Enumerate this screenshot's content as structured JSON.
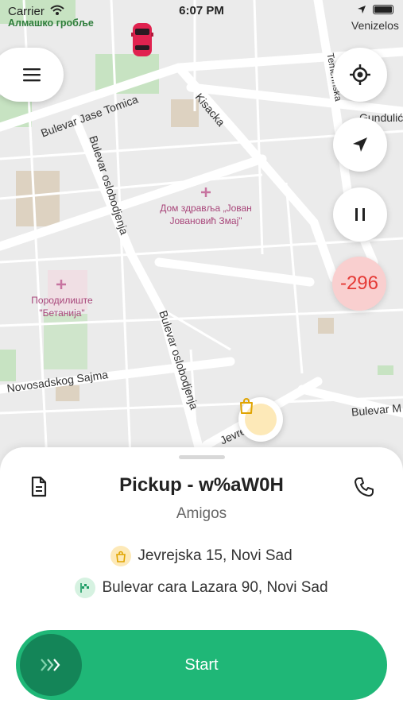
{
  "status_bar": {
    "carrier": "Carrier",
    "time": "6:07 PM"
  },
  "map": {
    "cemetery_label": "Алмашко гробље",
    "street_labels": {
      "bulevar_jase_tomica": "Bulevar Jase Tomica",
      "kisacka": "Kisacka",
      "bulevar_oslobodjenja_1": "Bulevar oslobodjenja",
      "bulevar_oslobodjenja_2": "Bulevar oslobodjenja",
      "novosadskog_sajma": "Novosadskog Sajma",
      "venizelosova": "Venizelos",
      "temerinska": "Temerinska",
      "gundulic": "Gundulić",
      "bulevar_m": "Bulevar M",
      "jevrejska": "Jevre"
    },
    "poi": {
      "dom_zdravlja": "Дом здравља „Јован Јовановић Змај\"",
      "porodiliste": "Породилиште \"Бетанија\""
    }
  },
  "controls": {
    "score_value": "-296",
    "icons": {
      "menu": "menu-icon",
      "locate": "crosshair-icon",
      "navigate": "navigation-arrow-icon",
      "pause": "pause-icon",
      "pickup_pin": "shopping-bag-icon"
    }
  },
  "order": {
    "title": "Pickup - w%aW0H",
    "restaurant": "Amigos",
    "pickup_address": "Jevrejska 15, Novi Sad",
    "dropoff_address": "Bulevar cara Lazara 90, Novi Sad"
  },
  "actions": {
    "start_label": "Start"
  },
  "colors": {
    "accent": "#1fb777",
    "accent_dark": "#148558",
    "score_bg": "#f9cfcf",
    "score_text": "#e53935",
    "car": "#e0224f"
  }
}
